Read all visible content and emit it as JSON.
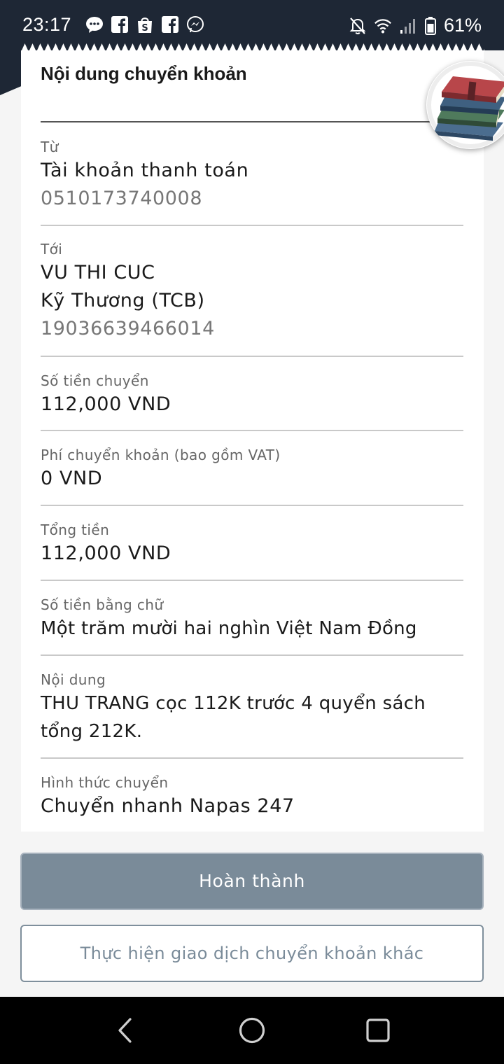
{
  "status_bar": {
    "time": "23:17",
    "battery": "61%",
    "app_icons": [
      "messenger-chat-icon",
      "facebook-icon",
      "shopee-icon",
      "facebook-icon",
      "messenger-icon"
    ],
    "system_icons": [
      "mute-bell-icon",
      "wifi-icon",
      "signal-icon",
      "battery-icon"
    ]
  },
  "receipt": {
    "title": "Nội dung chuyển khoản",
    "from": {
      "label": "Từ",
      "account_name": "Tài khoản thanh toán",
      "account_number": "0510173740008"
    },
    "to": {
      "label": "Tới",
      "name": "VU THI CUC",
      "bank": "Kỹ Thương (TCB)",
      "account_number": "19036639466014"
    },
    "amount": {
      "label": "Số tiền chuyển",
      "value": "112,000 VND"
    },
    "fee": {
      "label": "Phí chuyển khoản (bao gồm VAT)",
      "value": "0 VND"
    },
    "total": {
      "label": "Tổng tiền",
      "value": "112,000 VND"
    },
    "amount_words": {
      "label": "Số tiền bằng chữ",
      "value": "Một trăm mười hai nghìn Việt Nam Đồng"
    },
    "content": {
      "label": "Nội dung",
      "line1": "THU TRANG cọc 112K trước 4 quyển sách",
      "line2": "tổng 212K."
    },
    "method": {
      "label": "Hình thức chuyển",
      "value": "Chuyển nhanh Napas 247"
    }
  },
  "buttons": {
    "done": "Hoàn thành",
    "new_transfer": "Thực hiện giao dịch chuyển khoản khác"
  },
  "colors": {
    "status_bar": "#1e2735",
    "primary_button": "#7a8b99",
    "secondary_text": "#7a8b99"
  },
  "nav_bar": {
    "icons": [
      "back-icon",
      "home-icon",
      "recents-icon"
    ]
  }
}
